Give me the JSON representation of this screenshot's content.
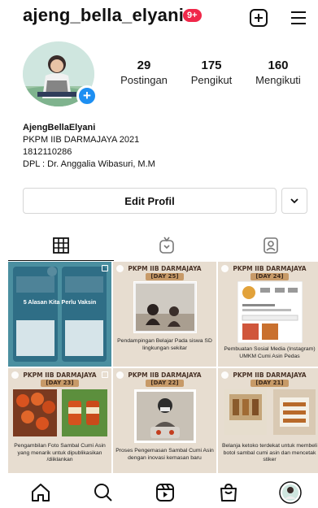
{
  "header": {
    "username": "ajeng_bella_elyani",
    "notification_count": "9+",
    "create_icon": "plus-square-icon",
    "menu_icon": "hamburger-menu-icon"
  },
  "profile": {
    "stats": [
      {
        "value": "29",
        "label": "Postingan"
      },
      {
        "value": "175",
        "label": "Pengikut"
      },
      {
        "value": "160",
        "label": "Mengikuti"
      }
    ],
    "bio": {
      "name": "AjengBellaElyani",
      "line1": "PKPM IIB DARMAJAYA 2021",
      "line2": "1812110286",
      "line3": "DPL : Dr. Anggalia Wibasuri, M.M"
    },
    "edit_label": "Edit Profil"
  },
  "tabs": [
    {
      "name": "grid",
      "icon": "grid-icon",
      "active": true
    },
    {
      "name": "igtv",
      "icon": "igtv-icon",
      "active": false
    },
    {
      "name": "tagged",
      "icon": "tagged-person-icon",
      "active": false
    }
  ],
  "posts": [
    {
      "header": "",
      "day": "",
      "caption_top": "5 Alasan Kita Perlu Vaksin",
      "caption": ""
    },
    {
      "header": "PKPM IIB DARMAJAYA",
      "day": "[DAY 25]",
      "caption": "Pendampingan Belajar Pada siswa SD lingkungan sekitar"
    },
    {
      "header": "PKPM IIB DARMAJAYA",
      "day": "[DAY 24]",
      "caption": "Pembuatan Sosial Media (Instagram) UMKM Cumi Asin Pedas"
    },
    {
      "header": "PKPM IIB DARMAJAYA",
      "day": "[DAY 23]",
      "caption": "Pengambilan Foto Sambal Cumi Asin yang menarik untuk dipublikasikan /diiklankan"
    },
    {
      "header": "PKPM IIB DARMAJAYA",
      "day": "[DAY 22]",
      "caption": "Proses Pengemasan Sambal Cumi Asin dengan inovasi kemasan baru"
    },
    {
      "header": "PKPM IIB DARMAJAYA",
      "day": "[DAY 21]",
      "caption": "Belanja ketoko terdekat untuk membeli botol sambal cumi asin dan mencetak stiker"
    }
  ],
  "bottom_nav": [
    {
      "name": "home",
      "icon": "home-icon"
    },
    {
      "name": "search",
      "icon": "search-icon"
    },
    {
      "name": "reels",
      "icon": "reels-icon"
    },
    {
      "name": "shop",
      "icon": "shopping-bag-icon"
    },
    {
      "name": "profile",
      "icon": "profile-avatar-icon"
    }
  ],
  "colors": {
    "badge_red": "#f0284a",
    "add_blue": "#1d8ff2",
    "post_bg": "#e7ddd0",
    "post_accent": "#c79a68"
  }
}
